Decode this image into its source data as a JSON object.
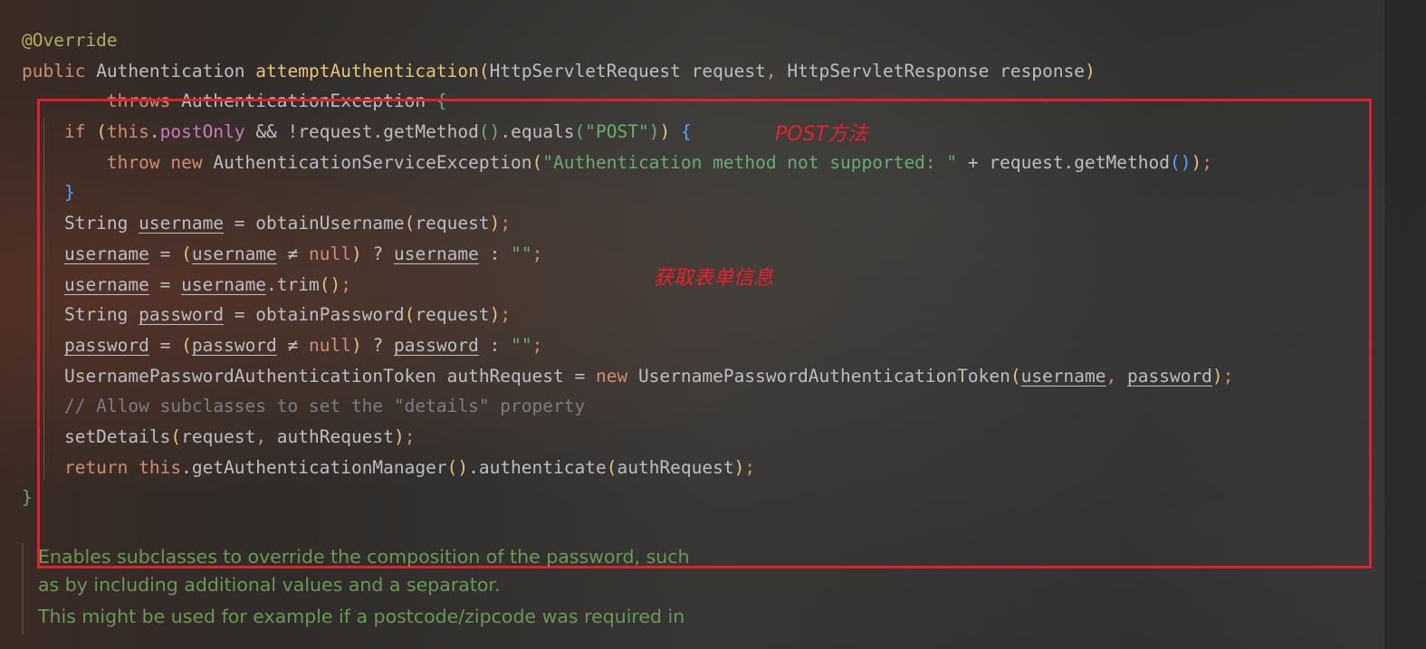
{
  "colors": {
    "keyword": "#cf8e6d",
    "annotation": "#b3ae60",
    "method_decl": "#56a8f5",
    "field": "#c77dbb",
    "string": "#6aab73",
    "comment": "#7a7e85",
    "default_text": "#bcbec4",
    "bracket_gold": "#e5c07b",
    "bracket_blue": "#4fa3ff",
    "bracket_green": "#6aab73",
    "doc_text": "#6a9955",
    "note_red": "#e8222b",
    "highlight_box": "#e0202a"
  },
  "code_lines": [
    [
      {
        "t": "@Override",
        "c": "#b3ae60"
      }
    ],
    [
      {
        "t": "public ",
        "c": "#cf8e6d"
      },
      {
        "t": "Authentication ",
        "c": "#bcbec4"
      },
      {
        "t": "attemptAuthentication",
        "c": "#e8c474"
      },
      {
        "t": "(",
        "c": "#e5c07b"
      },
      {
        "t": "HttpServletRequest request",
        "c": "#bcbec4"
      },
      {
        "t": ", ",
        "c": "#cf8e6d"
      },
      {
        "t": "HttpServletResponse response",
        "c": "#bcbec4"
      },
      {
        "t": ")",
        "c": "#e5c07b"
      }
    ],
    [
      {
        "t": "        throws ",
        "c": "#cf8e6d"
      },
      {
        "t": "AuthenticationException ",
        "c": "#bcbec4"
      },
      {
        "t": "{",
        "c": "#6aab73"
      }
    ],
    [
      {
        "t": "    if ",
        "c": "#cf8e6d"
      },
      {
        "t": "(",
        "c": "#e5c07b"
      },
      {
        "t": "this",
        "c": "#cf8e6d"
      },
      {
        "t": ".",
        "c": "#bcbec4"
      },
      {
        "t": "postOnly",
        "c": "#c77dbb"
      },
      {
        "t": " && !request.getMethod",
        "c": "#bcbec4"
      },
      {
        "t": "()",
        "c": "#6aab73"
      },
      {
        "t": ".equals",
        "c": "#bcbec4"
      },
      {
        "t": "(",
        "c": "#6aab73"
      },
      {
        "t": "\"POST\"",
        "c": "#6aab73"
      },
      {
        "t": ")",
        "c": "#6aab73"
      },
      {
        "t": ")",
        "c": "#e5c07b"
      },
      {
        "t": " {",
        "c": "#4fa3ff"
      }
    ],
    [
      {
        "t": "        throw new ",
        "c": "#cf8e6d"
      },
      {
        "t": "AuthenticationServiceException",
        "c": "#bcbec4"
      },
      {
        "t": "(",
        "c": "#e5c07b"
      },
      {
        "t": "\"Authentication method not supported: \"",
        "c": "#6aab73"
      },
      {
        "t": " + request.getMethod",
        "c": "#bcbec4"
      },
      {
        "t": "()",
        "c": "#4fa3ff"
      },
      {
        "t": ")",
        "c": "#e5c07b"
      },
      {
        "t": ";",
        "c": "#cf8e6d"
      }
    ],
    [
      {
        "t": "    }",
        "c": "#4fa3ff"
      }
    ],
    [
      {
        "t": "    String ",
        "c": "#bcbec4"
      },
      {
        "t": "username",
        "c": "#bcbec4",
        "u": true
      },
      {
        "t": " = obtainUsername",
        "c": "#bcbec4"
      },
      {
        "t": "(",
        "c": "#e5c07b"
      },
      {
        "t": "request",
        "c": "#bcbec4"
      },
      {
        "t": ")",
        "c": "#e5c07b"
      },
      {
        "t": ";",
        "c": "#cf8e6d"
      }
    ],
    [
      {
        "t": "    ",
        "c": "#bcbec4"
      },
      {
        "t": "username",
        "c": "#bcbec4",
        "u": true
      },
      {
        "t": " = ",
        "c": "#bcbec4"
      },
      {
        "t": "(",
        "c": "#e5c07b"
      },
      {
        "t": "username",
        "c": "#bcbec4",
        "u": true
      },
      {
        "t": " ≠ ",
        "c": "#bcbec4"
      },
      {
        "t": "null",
        "c": "#cf8e6d"
      },
      {
        "t": ")",
        "c": "#e5c07b"
      },
      {
        "t": " ? ",
        "c": "#bcbec4"
      },
      {
        "t": "username",
        "c": "#bcbec4",
        "u": true
      },
      {
        "t": " : ",
        "c": "#bcbec4"
      },
      {
        "t": "\"\"",
        "c": "#6aab73"
      },
      {
        "t": ";",
        "c": "#cf8e6d"
      }
    ],
    [
      {
        "t": "    ",
        "c": "#bcbec4"
      },
      {
        "t": "username",
        "c": "#bcbec4",
        "u": true
      },
      {
        "t": " = ",
        "c": "#bcbec4"
      },
      {
        "t": "username",
        "c": "#bcbec4",
        "u": true
      },
      {
        "t": ".trim",
        "c": "#bcbec4"
      },
      {
        "t": "()",
        "c": "#e5c07b"
      },
      {
        "t": ";",
        "c": "#cf8e6d"
      }
    ],
    [
      {
        "t": "    String ",
        "c": "#bcbec4"
      },
      {
        "t": "password",
        "c": "#bcbec4",
        "u": true
      },
      {
        "t": " = obtainPassword",
        "c": "#bcbec4"
      },
      {
        "t": "(",
        "c": "#e5c07b"
      },
      {
        "t": "request",
        "c": "#bcbec4"
      },
      {
        "t": ")",
        "c": "#e5c07b"
      },
      {
        "t": ";",
        "c": "#cf8e6d"
      }
    ],
    [
      {
        "t": "    ",
        "c": "#bcbec4"
      },
      {
        "t": "password",
        "c": "#bcbec4",
        "u": true
      },
      {
        "t": " = ",
        "c": "#bcbec4"
      },
      {
        "t": "(",
        "c": "#e5c07b"
      },
      {
        "t": "password",
        "c": "#bcbec4",
        "u": true
      },
      {
        "t": " ≠ ",
        "c": "#bcbec4"
      },
      {
        "t": "null",
        "c": "#cf8e6d"
      },
      {
        "t": ")",
        "c": "#e5c07b"
      },
      {
        "t": " ? ",
        "c": "#bcbec4"
      },
      {
        "t": "password",
        "c": "#bcbec4",
        "u": true
      },
      {
        "t": " : ",
        "c": "#bcbec4"
      },
      {
        "t": "\"\"",
        "c": "#6aab73"
      },
      {
        "t": ";",
        "c": "#cf8e6d"
      }
    ],
    [
      {
        "t": "    UsernamePasswordAuthenticationToken authRequest = ",
        "c": "#bcbec4"
      },
      {
        "t": "new ",
        "c": "#cf8e6d"
      },
      {
        "t": "UsernamePasswordAuthenticationToken",
        "c": "#bcbec4"
      },
      {
        "t": "(",
        "c": "#e5c07b"
      },
      {
        "t": "username",
        "c": "#bcbec4",
        "u": true
      },
      {
        "t": ", ",
        "c": "#cf8e6d"
      },
      {
        "t": "password",
        "c": "#bcbec4",
        "u": true
      },
      {
        "t": ")",
        "c": "#e5c07b"
      },
      {
        "t": ";",
        "c": "#cf8e6d"
      }
    ],
    [
      {
        "t": "    // Allow subclasses to set the \"details\" property",
        "c": "#7a7e85"
      }
    ],
    [
      {
        "t": "    setDetails",
        "c": "#bcbec4"
      },
      {
        "t": "(",
        "c": "#e5c07b"
      },
      {
        "t": "request",
        "c": "#bcbec4"
      },
      {
        "t": ", ",
        "c": "#cf8e6d"
      },
      {
        "t": "authRequest",
        "c": "#bcbec4"
      },
      {
        "t": ")",
        "c": "#e5c07b"
      },
      {
        "t": ";",
        "c": "#cf8e6d"
      }
    ],
    [
      {
        "t": "    return ",
        "c": "#cf8e6d"
      },
      {
        "t": "this",
        "c": "#cf8e6d"
      },
      {
        "t": ".getAuthenticationManager",
        "c": "#bcbec4"
      },
      {
        "t": "()",
        "c": "#e5c07b"
      },
      {
        "t": ".authenticate",
        "c": "#bcbec4"
      },
      {
        "t": "(",
        "c": "#e5c07b"
      },
      {
        "t": "authRequest",
        "c": "#bcbec4"
      },
      {
        "t": ")",
        "c": "#e5c07b"
      },
      {
        "t": ";",
        "c": "#cf8e6d"
      }
    ],
    [
      {
        "t": "}",
        "c": "#6aab73"
      }
    ]
  ],
  "annotations": {
    "post_method_note": "POST方法",
    "form_info_note": "获取表单信息"
  },
  "doc_comment": {
    "paragraph1_line1": "Enables subclasses to override the composition of the password, such",
    "paragraph1_line2": "as by including additional values and a separator.",
    "paragraph2_line1": "This might be used for example if a postcode/zipcode was required in"
  }
}
